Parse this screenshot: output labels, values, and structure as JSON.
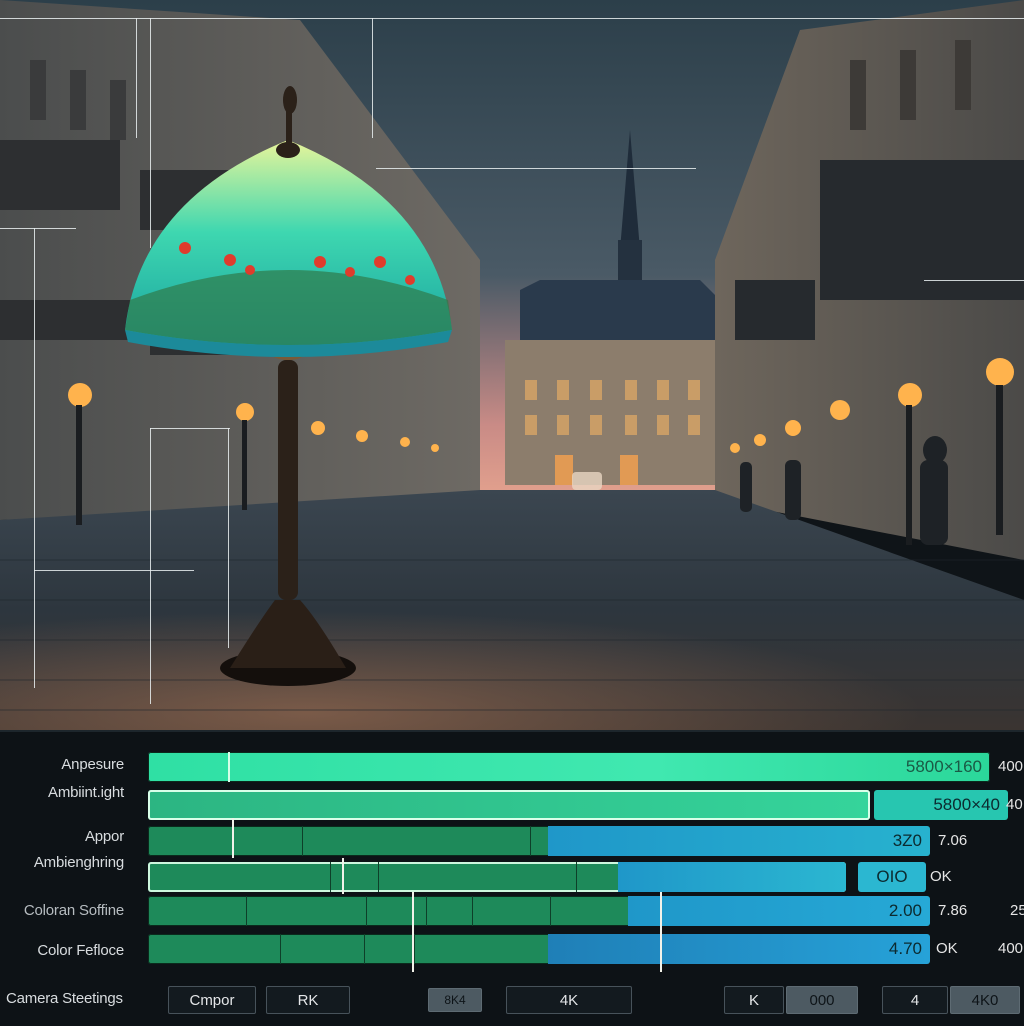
{
  "panel": {
    "rows": [
      {
        "label": "Anpesure",
        "value": "5800×160",
        "side": "400"
      },
      {
        "label": "Ambiint.ight",
        "value": "5800×40",
        "side": "40"
      },
      {
        "label": "Appor",
        "value": "3Z0",
        "side": "7.06"
      },
      {
        "label": "Ambienghring",
        "value": "OIO",
        "side": "OK"
      },
      {
        "label": "Coloran Soffine",
        "value": "2.00",
        "side": "7.86",
        "side2": "25"
      },
      {
        "label": "Color Fefloce",
        "value": "4.70",
        "side": "OK",
        "side2": "400"
      }
    ],
    "footer": {
      "label": "Camera Steetings",
      "buttons": [
        "Cmpor",
        "RK",
        "8K4",
        "4K",
        "K",
        "000",
        "4",
        "4K0"
      ]
    },
    "levels": [
      0.86,
      0.88,
      0.52,
      0.58,
      0.28,
      0.41
    ]
  },
  "colors": {
    "accent": "#2fe0a4",
    "bar_green": "#1e8a5a",
    "bar_blue": "#1f97c9",
    "sky": "#3a4e5b",
    "lamp_glow": "#ffb34d"
  }
}
